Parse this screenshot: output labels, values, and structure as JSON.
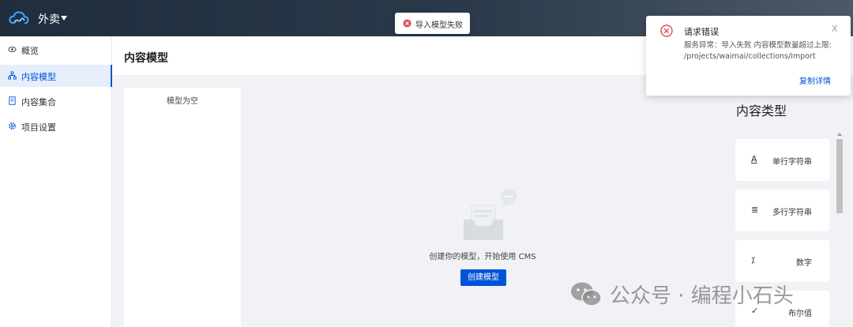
{
  "header": {
    "project_name": "外卖"
  },
  "sidebar": {
    "items": [
      {
        "label": "概览",
        "icon": "eye-icon"
      },
      {
        "label": "内容模型",
        "icon": "model-tree-icon",
        "active": true
      },
      {
        "label": "内容集合",
        "icon": "collection-icon"
      },
      {
        "label": "项目设置",
        "icon": "gear-icon"
      }
    ]
  },
  "page": {
    "title": "内容模型"
  },
  "model_list": {
    "empty_text": "模型为空"
  },
  "empty_state": {
    "text": "创建你的模型，开始使用 CMS",
    "create_button": "创建模型"
  },
  "content_types": {
    "title": "内容类型",
    "items": [
      {
        "label": "单行字符串",
        "icon": "single-line-text-icon",
        "glyph": "A"
      },
      {
        "label": "多行字符串",
        "icon": "multi-line-text-icon",
        "glyph": "≣"
      },
      {
        "label": "数字",
        "icon": "number-icon",
        "glyph": "⁒"
      },
      {
        "label": "布尔值",
        "icon": "boolean-check-icon",
        "glyph": "✓"
      }
    ]
  },
  "toast": {
    "message": "导入模型失败"
  },
  "notification": {
    "title": "请求错误",
    "body": "服务异常：导入失败 内容模型数量超过上限: /projects/waimai/collections/import",
    "close": "X",
    "link": "复制详情"
  },
  "watermark": {
    "text": "公众号 · 编程小石头"
  },
  "colors": {
    "primary": "#0052d9",
    "error": "#e34d59",
    "topbar": "#1f2d3d"
  }
}
